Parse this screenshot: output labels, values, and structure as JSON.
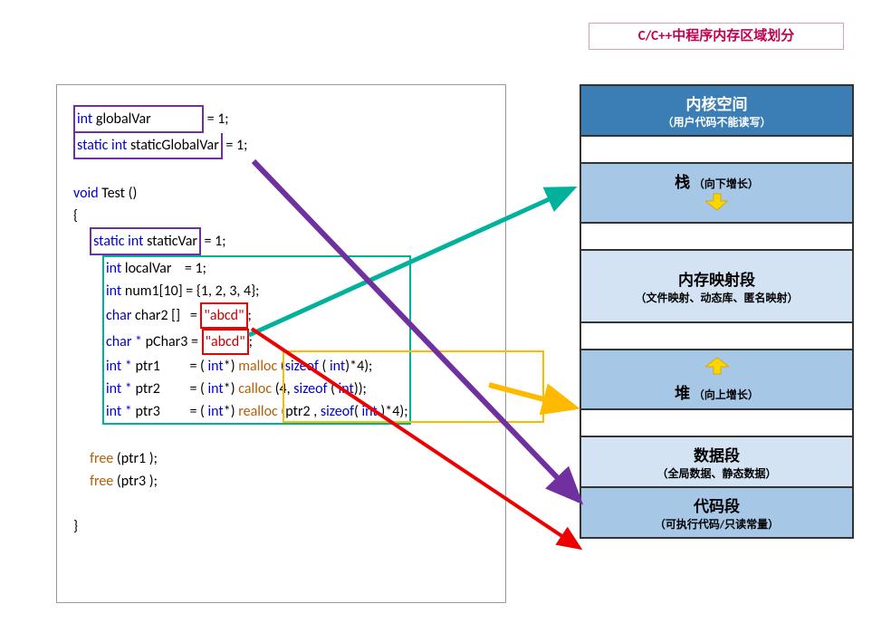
{
  "title": "C/C++中程序内存区域划分",
  "code": {
    "l1a": "int ",
    "l1b": "globalVar",
    "l1c": " = 1;",
    "l2a": "static int ",
    "l2b": "staticGlobalVar",
    "l2c": " = 1;",
    "l3": "void ",
    "l3b": "Test ()",
    "l4": "{",
    "l5a": "static int ",
    "l5b": "staticVar",
    "l5c": " = 1;",
    "l6a": "int ",
    "l6b": "localVar",
    "l6c": "    = 1;",
    "l7a": "int ",
    "l7b": "num1[10]",
    "l7c": " = {1, 2, 3, 4};",
    "l8a": "char ",
    "l8b": "char2 []   = ",
    "l8s": "\"abcd\"",
    "l8e": ";",
    "l9a": "char * ",
    "l9b": "pChar3 = ",
    "l9s": "\"abcd\"",
    "l9e": ";",
    "l10a": "int * ",
    "l10b": "ptr1         = ( ",
    "l10c": "int",
    "l10d": "*) ",
    "l10f": "malloc ",
    "l10g": "(",
    "l10h": "sizeof ",
    "l10i": "( ",
    "l10j": "int",
    "l10k": ")*4);",
    "l11a": "int * ",
    "l11b": "ptr2         = ( ",
    "l11c": "int",
    "l11d": "*) ",
    "l11f": "calloc ",
    "l11g": "(4, ",
    "l11h": "sizeof ",
    "l11i": "( ",
    "l11j": "int",
    "l11k": "));",
    "l12a": "int * ",
    "l12b": "ptr3         = ( ",
    "l12c": "int",
    "l12d": "*) ",
    "l12f": "realloc ",
    "l12g": "(ptr2 , ",
    "l12h": "sizeof",
    "l12i": "( ",
    "l12j": "int ",
    "l12k": ")*4);",
    "l13": "free ",
    "l13b": "(ptr1 );",
    "l14": "free ",
    "l14b": "(ptr3 );",
    "l15": "}"
  },
  "mem": {
    "s1t": "内核空间",
    "s1s": "（用户代码不能读写）",
    "s2t": "栈 ",
    "s2s": "（向下增长）",
    "s3t": "内存映射段",
    "s3s": "（文件映射、动态库、匿名映射）",
    "s4t": "堆 ",
    "s4s": "（向上增长）",
    "s5t": "数据段",
    "s5s": "（全局数据、静态数据）",
    "s6t": "代码段",
    "s6s": "（可执行代码/只读常量）"
  },
  "arrows": [
    {
      "name": "teal",
      "from": "localVars",
      "to": "stack",
      "color": "#00b29c"
    },
    {
      "name": "purple",
      "from": "globals",
      "to": "data",
      "color": "#7030a0"
    },
    {
      "name": "orange",
      "from": "malloc",
      "to": "heap",
      "color": "#ffba00"
    },
    {
      "name": "red",
      "from": "string-literal",
      "to": "code",
      "color": "#e00"
    }
  ]
}
